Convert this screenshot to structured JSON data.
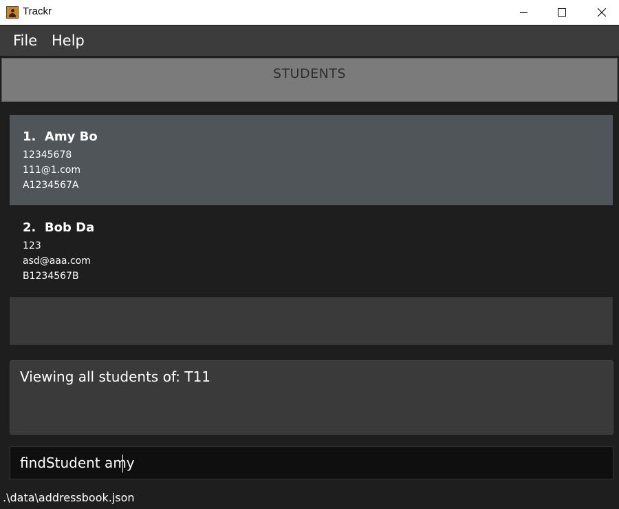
{
  "window": {
    "title": "Trackr",
    "icon": "app-icon",
    "controls": [
      "minimize-icon",
      "maximize-icon",
      "close-icon"
    ]
  },
  "menu": {
    "items": [
      {
        "label": "File"
      },
      {
        "label": "Help"
      }
    ]
  },
  "header": {
    "title": "STUDENTS"
  },
  "students": [
    {
      "index": "1.",
      "name": "Amy Bo",
      "phone": "12345678",
      "email": "111@1.com",
      "id": "A1234567A",
      "selected": true
    },
    {
      "index": "2.",
      "name": "Bob Da",
      "phone": "123",
      "email": "asd@aaa.com",
      "id": "B1234567B",
      "selected": false
    }
  ],
  "result": {
    "text": "Viewing all students of: T11"
  },
  "command": {
    "value": "findStudent amy"
  },
  "status": {
    "path": ".\\data\\addressbook.json"
  },
  "colors": {
    "background": "#1e1e1e",
    "menubar": "#3c3c3c",
    "header": "#7b7b7b",
    "selected_card": "#4f5559",
    "panel": "#3a3a3a",
    "command_bg": "#0f0f0f"
  }
}
